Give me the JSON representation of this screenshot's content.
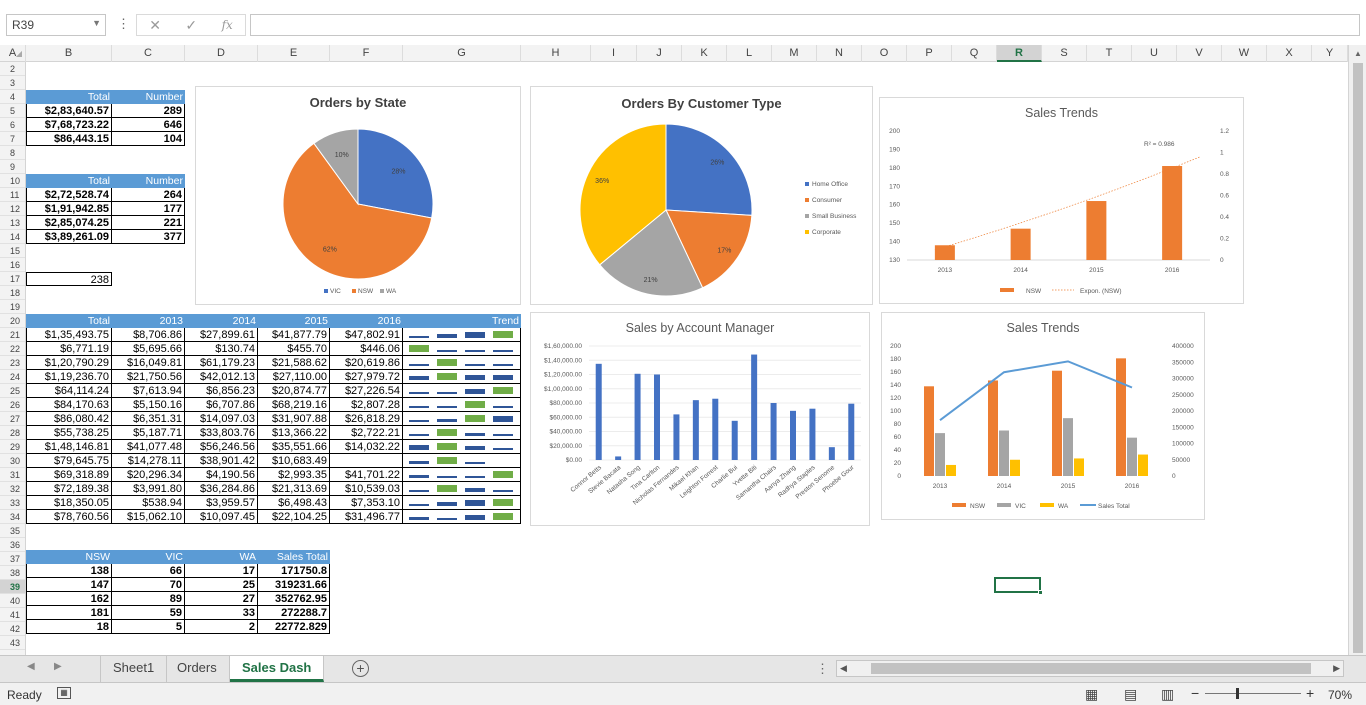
{
  "formula_bar": {
    "name_box": "R39",
    "fx": "fx"
  },
  "columns": [
    "A",
    "B",
    "C",
    "D",
    "E",
    "F",
    "G",
    "H",
    "I",
    "J",
    "K",
    "L",
    "M",
    "N",
    "O",
    "P",
    "Q",
    "R",
    "S",
    "T",
    "U",
    "V",
    "W",
    "X",
    "Y"
  ],
  "selected_col": "R",
  "rows": [
    "2",
    "3",
    "4",
    "5",
    "6",
    "7",
    "8",
    "9",
    "10",
    "11",
    "12",
    "13",
    "14",
    "15",
    "16",
    "17",
    "18",
    "19",
    "20",
    "21",
    "22",
    "23",
    "24",
    "25",
    "26",
    "27",
    "28",
    "29",
    "30",
    "31",
    "32",
    "33",
    "34",
    "35",
    "36",
    "37",
    "38",
    "39",
    "40",
    "41",
    "42",
    "43"
  ],
  "selected_row": "39",
  "t1": {
    "headers": [
      "Total",
      "Number"
    ],
    "rows": [
      [
        "$2,83,640.57",
        "289"
      ],
      [
        "$7,68,723.22",
        "646"
      ],
      [
        "$86,443.15",
        "104"
      ]
    ]
  },
  "t2": {
    "headers": [
      "Total",
      "Number"
    ],
    "rows": [
      [
        "$2,72,528.74",
        "264"
      ],
      [
        "$1,91,942.85",
        "177"
      ],
      [
        "$2,85,074.25",
        "221"
      ],
      [
        "$3,89,261.09",
        "377"
      ]
    ]
  },
  "single_cell": "238",
  "t3": {
    "headers": [
      "Total",
      "2013",
      "2014",
      "2015",
      "2016",
      "Trend"
    ],
    "rows": [
      [
        "$1,35,493.75",
        "$8,706.86",
        "$27,899.61",
        "$41,877.79",
        "$47,802.91"
      ],
      [
        "$6,771.19",
        "$5,695.66",
        "$130.74",
        "$455.70",
        "$446.06"
      ],
      [
        "$1,20,790.29",
        "$16,049.81",
        "$61,179.23",
        "$21,588.62",
        "$20,619.86"
      ],
      [
        "$1,19,236.70",
        "$21,750.56",
        "$42,012.13",
        "$27,110.00",
        "$27,979.72"
      ],
      [
        "$64,114.24",
        "$7,613.94",
        "$6,856.23",
        "$20,874.77",
        "$27,226.54"
      ],
      [
        "$84,170.63",
        "$5,150.16",
        "$6,707.86",
        "$68,219.16",
        "$2,807.28"
      ],
      [
        "$86,080.42",
        "$6,351.31",
        "$14,097.03",
        "$31,907.88",
        "$26,818.29"
      ],
      [
        "$55,738.25",
        "$5,187.71",
        "$33,803.76",
        "$13,366.22",
        "$2,722.21"
      ],
      [
        "$1,48,146.81",
        "$41,077.48",
        "$56,246.56",
        "$35,551.66",
        "$14,032.22"
      ],
      [
        "$79,645.75",
        "$14,278.11",
        "$38,901.42",
        "$10,683.49"
      ],
      [
        "$69,318.89",
        "$20,296.34",
        "$4,190.56",
        "$2,993.35",
        "$41,701.22"
      ],
      [
        "$72,189.38",
        "$3,991.80",
        "$36,284.86",
        "$21,313.69",
        "$10,539.03"
      ],
      [
        "$18,350.05",
        "$538.94",
        "$3,959.57",
        "$6,498.43",
        "$7,353.10"
      ],
      [
        "$78,760.56",
        "$15,062.10",
        "$10,097.45",
        "$22,104.25",
        "$31,496.77"
      ]
    ]
  },
  "t4": {
    "headers": [
      "NSW",
      "VIC",
      "WA",
      "Sales Total"
    ],
    "rows": [
      [
        "138",
        "66",
        "17",
        "171750.8"
      ],
      [
        "147",
        "70",
        "25",
        "319231.66"
      ],
      [
        "162",
        "89",
        "27",
        "352762.95"
      ],
      [
        "181",
        "59",
        "33",
        "272288.7"
      ],
      [
        "18",
        "5",
        "2",
        "22772.829"
      ]
    ]
  },
  "chart_data": [
    {
      "type": "pie",
      "title": "Orders by State",
      "labels": [
        "VIC",
        "NSW",
        "WA"
      ],
      "values": [
        28,
        62,
        10
      ],
      "colors": [
        "#4472c4",
        "#ed7d31",
        "#a5a5a5"
      ],
      "data_labels": [
        "28%",
        "62%",
        "10%"
      ]
    },
    {
      "type": "pie",
      "title": "Orders By Customer Type",
      "labels": [
        "Home Office",
        "Consumer",
        "Small Business",
        "Corporate"
      ],
      "values": [
        26,
        17,
        21,
        36
      ],
      "colors": [
        "#4472c4",
        "#ed7d31",
        "#a5a5a5",
        "#ffc000"
      ],
      "data_labels": [
        "26%",
        "17%",
        "21%",
        "36%"
      ]
    },
    {
      "type": "bar",
      "title": "Sales Trends",
      "categories": [
        "2013",
        "2014",
        "2015",
        "2016"
      ],
      "series": [
        {
          "name": "NSW",
          "values": [
            138,
            147,
            162,
            181
          ]
        },
        {
          "name": "Expon. (NSW)"
        }
      ],
      "ylim": [
        130,
        200
      ],
      "yticks": [
        "200",
        "190",
        "180",
        "170",
        "160",
        "150",
        "140",
        "130"
      ],
      "y2ticks": [
        "1.2",
        "1",
        "0.8",
        "0.6",
        "0.4",
        "0.2",
        "0"
      ],
      "annotation": "R² = 0.986"
    },
    {
      "type": "bar",
      "title": "Sales by Account Manager",
      "categories": [
        "Connor Betts",
        "Stevie Bacata",
        "Natasha Song",
        "Tina Carlton",
        "Nicholas Fernandes",
        "Mikael Khan",
        "Leighton Forrest",
        "Charlie Bui",
        "Yvette Biti",
        "Samantha Chairs",
        "Aanya Zhang",
        "Radhya Staples",
        "Preston Senome",
        "Phoebe Gour"
      ],
      "values": [
        135000,
        5000,
        121000,
        120000,
        64000,
        84000,
        86000,
        55000,
        148000,
        80000,
        69000,
        72000,
        18000,
        79000
      ],
      "ylim": [
        0,
        160000
      ],
      "yticks": [
        "$1,60,000.00",
        "$1,40,000.00",
        "$1,20,000.00",
        "$1,00,000.00",
        "$80,000.00",
        "$60,000.00",
        "$40,000.00",
        "$20,000.00",
        "$0.00"
      ]
    },
    {
      "type": "bar",
      "title": "Sales Trends",
      "categories": [
        "2013",
        "2014",
        "2015",
        "2016"
      ],
      "series": [
        {
          "name": "NSW",
          "values": [
            138,
            147,
            162,
            181
          ]
        },
        {
          "name": "VIC",
          "values": [
            66,
            70,
            89,
            59
          ]
        },
        {
          "name": "WA",
          "values": [
            17,
            25,
            27,
            33
          ]
        },
        {
          "name": "Sales Total",
          "values": [
            171750.8,
            319231.66,
            352762.95,
            272288.7
          ]
        }
      ],
      "ylim": [
        0,
        200
      ],
      "y2lim": [
        0,
        400000
      ],
      "yticks": [
        "200",
        "180",
        "160",
        "140",
        "120",
        "100",
        "80",
        "60",
        "40",
        "20",
        "0"
      ],
      "y2ticks": [
        "400000",
        "350000",
        "300000",
        "250000",
        "200000",
        "150000",
        "100000",
        "50000",
        "0"
      ]
    }
  ],
  "tabs": [
    "Sheet1",
    "Orders",
    "Sales Dash"
  ],
  "active_tab": "Sales Dash",
  "status": {
    "ready": "Ready",
    "zoom": "70%"
  }
}
